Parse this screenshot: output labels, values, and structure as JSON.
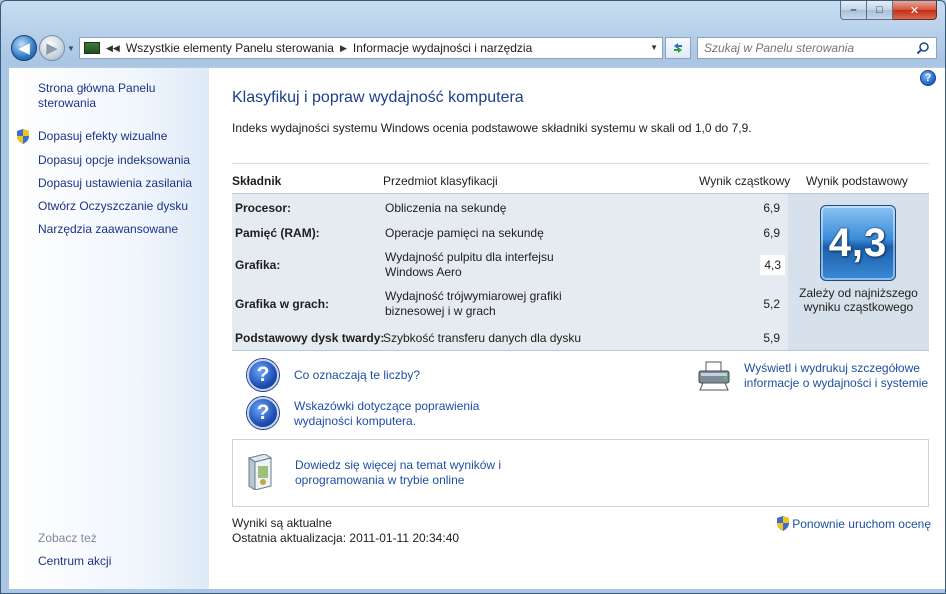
{
  "window": {
    "caption_buttons": {
      "minimize": "–",
      "maximize": "□",
      "close": "✕"
    }
  },
  "nav": {
    "back_glyph": "◀",
    "forward_glyph": "▶",
    "breadcrumb": [
      "Wszystkie elementy Panelu sterowania",
      "Informacje wydajności i narzędzia"
    ],
    "address_prefix_glyph": "◀◀",
    "separator_glyph": "▶",
    "search_placeholder": "Szukaj w Panelu sterowania"
  },
  "sidebar": {
    "items": [
      {
        "label": "Strona główna Panelu sterowania",
        "icon": ""
      },
      {
        "label": "Dopasuj efekty wizualne",
        "icon": "shield-icon"
      },
      {
        "label": "Dopasuj opcje indeksowania",
        "icon": ""
      },
      {
        "label": "Dopasuj ustawienia zasilania",
        "icon": ""
      },
      {
        "label": "Otwórz Oczyszczanie dysku",
        "icon": ""
      },
      {
        "label": "Narzędzia zaawansowane",
        "icon": ""
      }
    ],
    "see_also_heading": "Zobacz też",
    "see_also_items": [
      "Centrum akcji"
    ]
  },
  "main": {
    "title": "Klasyfikuj i popraw wydajność komputera",
    "intro": "Indeks wydajności systemu Windows ocenia podstawowe składniki systemu w skali od 1,0 do 7,9.",
    "table": {
      "headers": [
        "Składnik",
        "Przedmiot klasyfikacji",
        "Wynik cząstkowy",
        "Wynik podstawowy"
      ],
      "rows": [
        {
          "component": "Procesor:",
          "rating": "Obliczenia na sekundę",
          "subscore": "6,9"
        },
        {
          "component": "Pamięć (RAM):",
          "rating": "Operacje pamięci na sekundę",
          "subscore": "6,9"
        },
        {
          "component": "Grafika:",
          "rating": "Wydajność pulpitu dla interfejsu Windows Aero",
          "subscore": "4,3"
        },
        {
          "component": "Grafika w grach:",
          "rating": "Wydajność trójwymiarowej grafiki biznesowej i w grach",
          "subscore": "5,2"
        },
        {
          "component": "Podstawowy dysk twardy:",
          "rating": "Szybkość transferu danych dla dysku",
          "subscore": "5,9"
        }
      ],
      "base_score": "4,3",
      "base_caption": "Zależy od najniższego wyniku cząstkowego"
    },
    "links": {
      "what_mean": "Co oznaczają te liczby?",
      "tips": "Wskazówki dotyczące poprawienia wydajności komputera.",
      "print_details": "Wyświetl i wydrukuj szczegółowe informacje o wydajności i systemie",
      "learn_more": "Dowiedz się więcej na temat wyników i oprogramowania w trybie online"
    },
    "status": {
      "current": "Wyniki są aktualne",
      "last_update": "Ostatnia aktualizacja: 2011-01-11 20:34:40",
      "rerun": "Ponownie uruchom ocenę"
    },
    "help_glyph": "?",
    "question_glyph": "?"
  }
}
